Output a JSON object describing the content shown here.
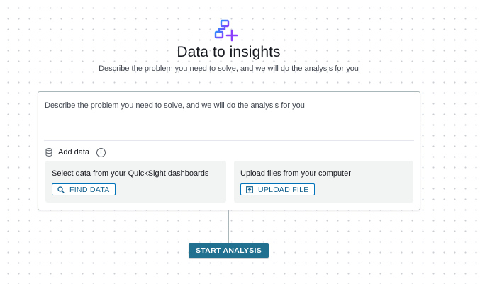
{
  "hero": {
    "icon": "workflow-plus-icon",
    "title": "Data to insights",
    "subtitle": "Describe the problem you need to solve, and we will do the analysis for you"
  },
  "prompt": {
    "placeholder": "Describe the problem you need to solve, and we will do the analysis for you"
  },
  "add_data": {
    "icon": "database-icon",
    "label": "Add data",
    "info_icon": "info-icon"
  },
  "sources": [
    {
      "title": "Select data from your QuickSight dashboards",
      "button_label": "FIND DATA",
      "button_icon": "search-icon"
    },
    {
      "title": "Upload files from your computer",
      "button_label": "UPLOAD FILE",
      "button_icon": "upload-icon"
    }
  ],
  "start_button": {
    "label": "START ANALYSIS"
  },
  "colors": {
    "primary_button": "#21708f",
    "link": "#0f5e8c",
    "icon_gradient_start": "#2d8cff",
    "icon_gradient_end": "#8a3ffc"
  }
}
